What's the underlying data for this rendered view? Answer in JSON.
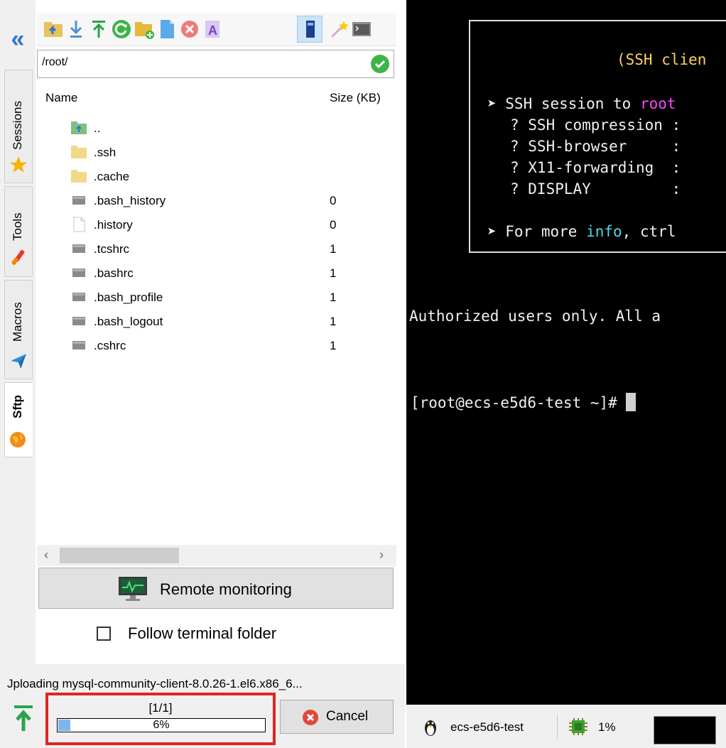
{
  "sidebar": {
    "tabs": [
      {
        "label": "Sessions",
        "icon": "star-icon"
      },
      {
        "label": "Tools",
        "icon": "wrench-icon"
      },
      {
        "label": "Macros",
        "icon": "paper-plane-icon"
      },
      {
        "label": "Sftp",
        "icon": "globe-icon",
        "active": true
      }
    ]
  },
  "toolbar": {
    "icons": [
      "parent-folder-icon",
      "download-icon",
      "upload-icon",
      "refresh-icon",
      "new-folder-icon",
      "new-file-icon",
      "delete-icon",
      "rename-icon",
      "properties-icon",
      "wand-icon",
      "terminal-icon"
    ]
  },
  "path": {
    "value": "/root/"
  },
  "file_list": {
    "columns": [
      "Name",
      "Size (KB)"
    ],
    "rows": [
      {
        "name": "..",
        "size": "",
        "icon": "parent-folder-icon"
      },
      {
        "name": ".ssh",
        "size": "",
        "icon": "folder-icon"
      },
      {
        "name": ".cache",
        "size": "",
        "icon": "folder-icon"
      },
      {
        "name": ".bash_history",
        "size": "0",
        "icon": "file-gray-icon"
      },
      {
        "name": ".history",
        "size": "0",
        "icon": "file-blank-icon"
      },
      {
        "name": ".tcshrc",
        "size": "1",
        "icon": "file-gray-icon"
      },
      {
        "name": ".bashrc",
        "size": "1",
        "icon": "file-gray-icon"
      },
      {
        "name": ".bash_profile",
        "size": "1",
        "icon": "file-gray-icon"
      },
      {
        "name": ".bash_logout",
        "size": "1",
        "icon": "file-gray-icon"
      },
      {
        "name": ".cshrc",
        "size": "1",
        "icon": "file-gray-icon"
      }
    ]
  },
  "remote_monitoring": {
    "label": "Remote monitoring"
  },
  "follow_folder": {
    "label": "Follow terminal folder",
    "checked": false
  },
  "upload": {
    "filename": "Jploading mysql-community-client-8.0.26-1.el6.x86_6...",
    "counter": "[1/1]",
    "percent_text": "6%",
    "progress": 0.06,
    "cancel_label": "Cancel"
  },
  "terminal": {
    "banner_title": "(SSH clien",
    "session_prefix": "➤ SSH session to ",
    "session_user": "root",
    "opts": [
      "? SSH compression :",
      "? SSH-browser     :",
      "? X11-forwarding  :",
      "? DISPLAY         :"
    ],
    "info_prefix": "➤ For more ",
    "info_word": "info",
    "info_suffix": ", ctrl",
    "authorized": "Authorized users only. All a",
    "prompt": "[root@ecs-e5d6-test ~]# "
  },
  "statusbar": {
    "host": "ecs-e5d6-test",
    "cpu": "1%"
  },
  "colors": {
    "accent_blue": "#2b76d0",
    "ok_green": "#3cb44a",
    "highlight_red": "#e0261f",
    "banner_yellow": "#ffd166",
    "magenta": "#ff44ff",
    "cyan": "#4fd6e6"
  }
}
